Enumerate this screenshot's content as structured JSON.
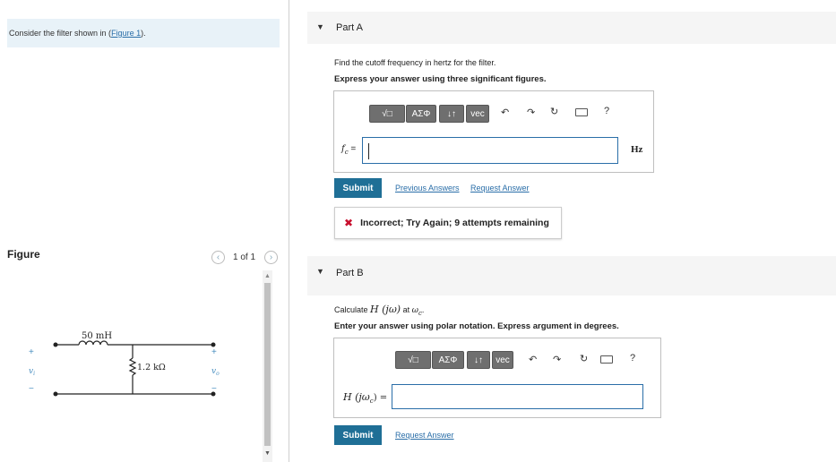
{
  "left_panel": {
    "intro_prefix": "Consider the filter shown in (",
    "intro_link": "Figure 1",
    "intro_suffix": ").",
    "figure_label": "Figure",
    "pager": "1 of 1",
    "circuit": {
      "inductor_label": "50 mH",
      "resistor_label": "1.2 kΩ",
      "vin_label": "v",
      "vin_sub": "i",
      "vout_label": "v",
      "vout_sub": "o",
      "plus": "+",
      "minus": "−"
    }
  },
  "part_a": {
    "title": "Part A",
    "question": "Find the cutoff frequency in hertz for the filter.",
    "instruction": "Express your answer using three significant figures.",
    "answer_label_var": "f",
    "answer_label_sub": "c",
    "answer_label_eq": " =",
    "answer_value": "",
    "unit": "Hz",
    "submit": "Submit",
    "previous_answers": "Previous Answers",
    "request_answer": "Request Answer",
    "feedback": "Incorrect; Try Again; 9 attempts remaining"
  },
  "part_b": {
    "title": "Part B",
    "question_prefix": "Calculate ",
    "question_math": "H (jω)",
    "question_mid": " at ",
    "question_var": "ω",
    "question_sub": "c",
    "question_end": ".",
    "instruction": "Enter your answer using polar notation. Express argument in degrees.",
    "answer_label": "H (jω",
    "answer_label_sub": "c",
    "answer_label_end": ") =",
    "answer_value": "",
    "submit": "Submit",
    "request_answer": "Request Answer"
  },
  "toolbar": {
    "templates": "√□",
    "greek": "ΑΣΦ",
    "arrows": "↓↑",
    "vec": "vec",
    "help": "?"
  },
  "colors": {
    "accent": "#1f6f96",
    "link": "#2a6ea8",
    "error": "#c8102e",
    "intro_bg": "#e8f2f8"
  }
}
